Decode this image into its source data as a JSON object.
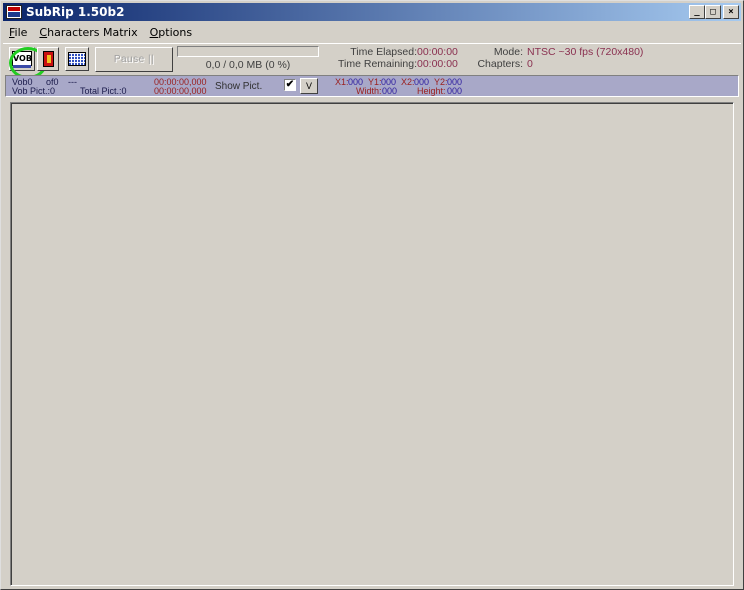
{
  "window": {
    "title": "SubRip 1.50b2",
    "buttons": {
      "minimize": "_",
      "maximize": "□",
      "close": "×"
    }
  },
  "menu": [
    {
      "label": "File",
      "accel": "F",
      "rest": "ile"
    },
    {
      "label": "Characters Matrix",
      "accel": "C",
      "rest": "haracters Matrix"
    },
    {
      "label": "Options",
      "accel": "O",
      "rest": "ptions"
    }
  ],
  "toolbar": {
    "vob_icon_text": "VOB",
    "pause_label": "Pause ||",
    "progress_fraction": 0,
    "size_text": "0,0 / 0,0 MB (0 %)",
    "time_elapsed_label": "Time Elapsed:",
    "time_elapsed_value": "00:00:00",
    "time_remaining_label": "Time Remaining:",
    "time_remaining_value": "00:00:00",
    "mode_label": "Mode:",
    "mode_value": "NTSC ~30 fps (720x480)",
    "chapters_label": "Chapters:",
    "chapters_value": "0"
  },
  "infobar": {
    "vob": "Vob0",
    "of": "of0",
    "dashes": "---",
    "vob_pict": "Vob Pict.:0",
    "total_pict": "Total Pict.:0",
    "time1": "00:00:00,000",
    "time2": "00:00:00,000",
    "show_pict_label": "Show Pict.",
    "show_pict_checked": "✔",
    "v_button": "V",
    "x1_label": "X1:",
    "x1_value": "000",
    "y1_label": "Y1:",
    "y1_value": "000",
    "x2_label": "X2:",
    "x2_value": "000",
    "y2_label": "Y2:",
    "y2_value": "000",
    "width_label": "Width:",
    "width_value": "000",
    "height_label": "Height:",
    "height_value": "000"
  },
  "colors": {
    "title_start": "#0a246a",
    "title_end": "#a6caf0",
    "highlight_circle": "#22cc22",
    "value_text": "#8a3050",
    "infobar_bg": "#a8a8c8"
  }
}
